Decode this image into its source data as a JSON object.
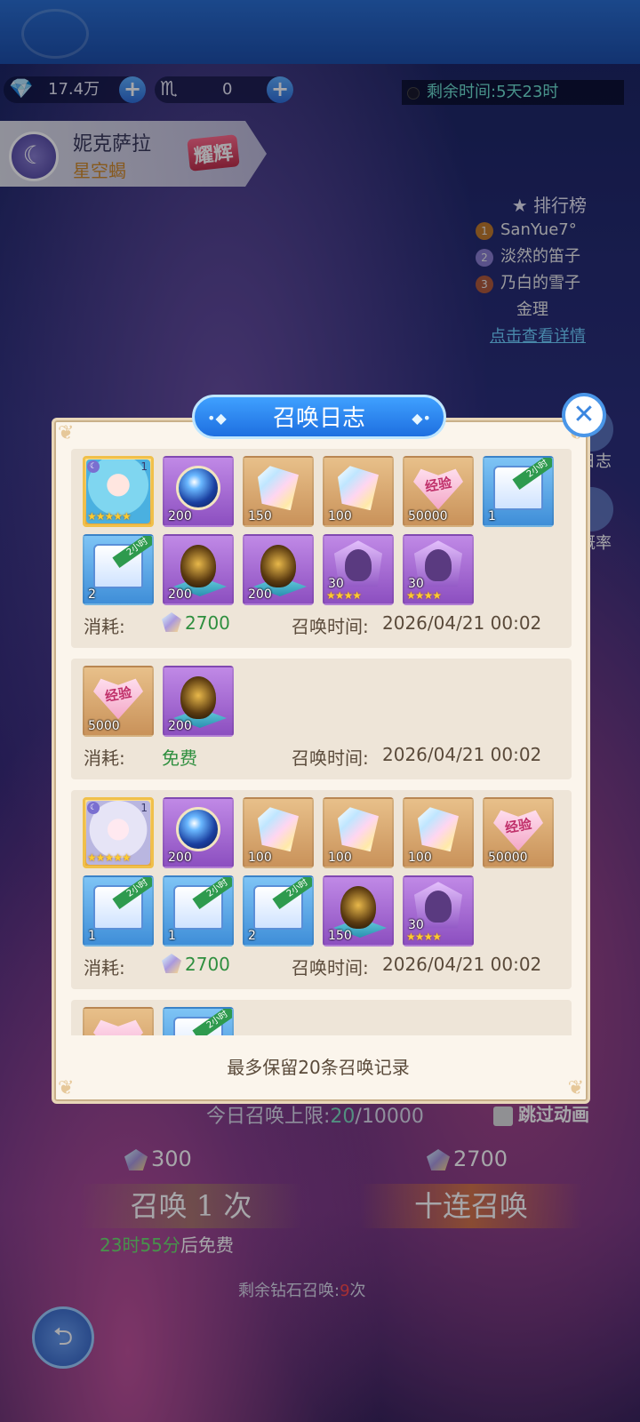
{
  "currency": {
    "primary_amount": "17.4万",
    "secondary_amount": "0"
  },
  "event": {
    "remaining_label": "剩余时间:",
    "remaining_value": "5天23时"
  },
  "hero": {
    "name": "妮克萨拉",
    "title": "星空蝎",
    "tag": "耀辉"
  },
  "ranking": {
    "title": "排行榜",
    "entries": [
      "SanYue7°",
      "淡然的笛子",
      "乃白的雪子",
      "金理"
    ],
    "details_link": "点击查看详情"
  },
  "side_labels": {
    "log": "日志",
    "rate": "概率"
  },
  "dialog": {
    "title": "召唤日志",
    "close_icon": "close-icon",
    "footer": "最多保留20条召唤记录",
    "records": [
      {
        "cost_label": "消耗:",
        "cost_value": "2700",
        "cost_gem": true,
        "time_label": "召唤时间:",
        "time_value": "2026/04/21 00:02",
        "items": [
          {
            "kind": "hero-blue",
            "rarity": "hero",
            "stars": "★★★★★",
            "level": "1"
          },
          {
            "kind": "orb",
            "rarity": "purple",
            "qty": "200"
          },
          {
            "kind": "crystal",
            "rarity": "gold",
            "qty": "150"
          },
          {
            "kind": "crystal",
            "rarity": "gold",
            "qty": "100"
          },
          {
            "kind": "heart",
            "rarity": "gold",
            "qty": "50000",
            "text": "经验"
          },
          {
            "kind": "chest",
            "rarity": "blue",
            "qty": "1",
            "badge": "2小时"
          },
          {
            "kind": "chest",
            "rarity": "blue",
            "qty": "2",
            "badge": "2小时"
          },
          {
            "kind": "egg",
            "rarity": "purple",
            "qty": "200"
          },
          {
            "kind": "egg",
            "rarity": "purple",
            "qty": "200"
          },
          {
            "kind": "shard",
            "rarity": "purple",
            "qty": "30",
            "stars": "★★★★"
          },
          {
            "kind": "shard",
            "rarity": "purple",
            "qty": "30",
            "stars": "★★★★"
          }
        ]
      },
      {
        "cost_label": "消耗:",
        "cost_value": "免费",
        "cost_gem": false,
        "time_label": "召唤时间:",
        "time_value": "2026/04/21 00:02",
        "items": [
          {
            "kind": "heart",
            "rarity": "gold",
            "qty": "5000",
            "text": "经验"
          },
          {
            "kind": "egg",
            "rarity": "purple",
            "qty": "200"
          }
        ]
      },
      {
        "cost_label": "消耗:",
        "cost_value": "2700",
        "cost_gem": true,
        "time_label": "召唤时间:",
        "time_value": "2026/04/21 00:02",
        "items": [
          {
            "kind": "hero-silver",
            "rarity": "hero",
            "stars": "★★★★★",
            "level": "1"
          },
          {
            "kind": "orb",
            "rarity": "purple",
            "qty": "200"
          },
          {
            "kind": "crystal",
            "rarity": "gold",
            "qty": "100"
          },
          {
            "kind": "crystal",
            "rarity": "gold",
            "qty": "100"
          },
          {
            "kind": "crystal",
            "rarity": "gold",
            "qty": "100"
          },
          {
            "kind": "heart",
            "rarity": "gold",
            "qty": "50000",
            "text": "经验"
          },
          {
            "kind": "chest",
            "rarity": "blue",
            "qty": "1",
            "badge": "2小时"
          },
          {
            "kind": "chest",
            "rarity": "blue",
            "qty": "1",
            "badge": "2小时"
          },
          {
            "kind": "chest",
            "rarity": "blue",
            "qty": "2",
            "badge": "2小时"
          },
          {
            "kind": "egg",
            "rarity": "purple",
            "qty": "150"
          },
          {
            "kind": "shard",
            "rarity": "purple",
            "qty": "30",
            "stars": "★★★★"
          }
        ]
      },
      {
        "partial": true,
        "items": [
          {
            "kind": "heart",
            "rarity": "gold"
          },
          {
            "kind": "chest",
            "rarity": "blue",
            "badge": "2小时"
          }
        ]
      }
    ]
  },
  "summon": {
    "limit_label": "今日召唤上限:",
    "limit_current": "20",
    "limit_max": "/10000",
    "skip_label": "跳过动画",
    "single_cost": "300",
    "ten_cost": "2700",
    "single_label": "召唤 1 次",
    "ten_label": "十连召唤",
    "free_timer": "23时55分",
    "free_suffix": "后免费",
    "diamond_left_label": "剩余钻石召唤:",
    "diamond_left_count": "9",
    "diamond_left_unit": "次"
  },
  "colors": {
    "accent": "#1e6fe0",
    "free_green": "#2f8f3f",
    "panel_bg": "#fbf5ec"
  }
}
